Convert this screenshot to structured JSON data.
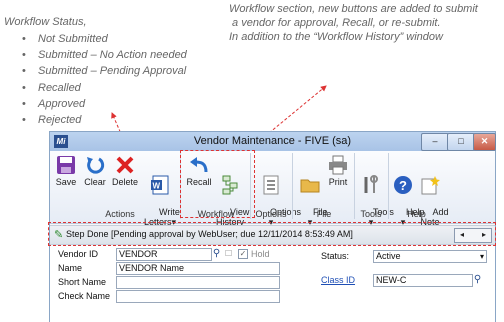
{
  "annotations": {
    "status_heading": "Workflow Status,",
    "status_items": [
      "Not Submitted",
      "Submitted – No Action needed",
      "Submitted – Pending Approval",
      "Recalled",
      "Approved",
      "Rejected"
    ],
    "right_line1": "Workflow section, new buttons are added to submit",
    "right_line2": " a vendor for approval, Recall, or re-submit.",
    "right_line3": "In addition to the “Workflow History” window"
  },
  "window": {
    "logo": "Mi",
    "title": "Vendor Maintenance  -  FIVE (sa)",
    "min_label": "–",
    "max_label": "□",
    "close_label": "✕"
  },
  "ribbon": {
    "buttons": {
      "save": "Save",
      "clear": "Clear",
      "delete": "Delete",
      "write_letters": "Write\nLetters▾",
      "recall": "Recall",
      "view_history": "View\nHistory",
      "options": "Options\n▾",
      "file": "File\n▾",
      "print": "Print",
      "tools": "Tools\n▾",
      "help": "Help\n▾",
      "add_note": "Add\nNote"
    },
    "groups": {
      "actions": "Actions",
      "workflow": "Workflow",
      "options": "Options",
      "file": "File",
      "tools": "Tools",
      "help": "Help"
    }
  },
  "step_bar": {
    "text": "Step Done [Pending approval by WebUser; due 12/11/2014 8:53:49 AM]",
    "prev": "◂",
    "next": "▸"
  },
  "form": {
    "vendor_id_label": "Vendor ID",
    "vendor_id_value": "VENDOR",
    "hold_label": "Hold",
    "name_label": "Name",
    "name_value": "VENDOR Name",
    "short_name_label": "Short Name",
    "check_name_label": "Check Name",
    "status_label": "Status:",
    "status_value": "Active",
    "class_id_label": "Class ID",
    "class_id_value": "NEW-C"
  },
  "colors": {
    "accent": "#1f4fb5",
    "callout": "#d33333",
    "title_bar": "#bcd3ef"
  }
}
